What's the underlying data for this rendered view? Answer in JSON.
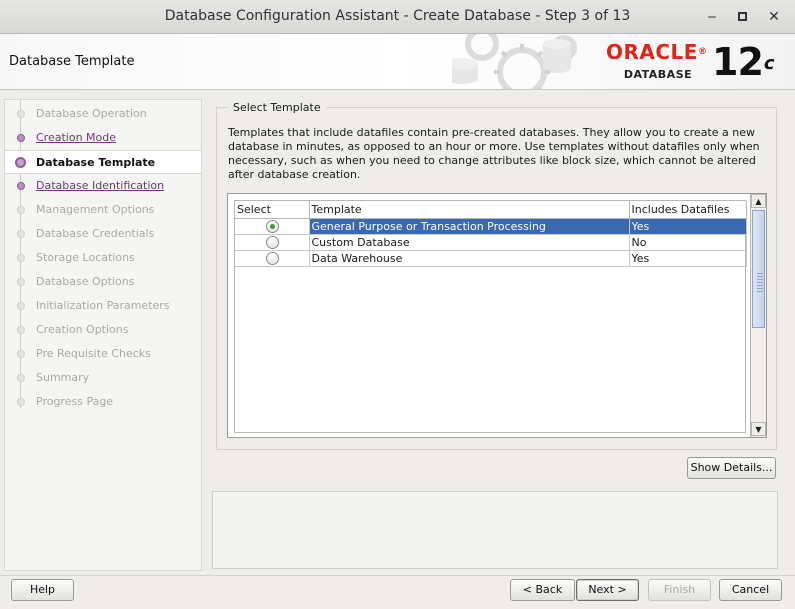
{
  "window": {
    "title": "Database Configuration Assistant - Create Database - Step 3 of 13",
    "minimize_glyph": "‒",
    "maximize_glyph": "■",
    "close_glyph": "✕"
  },
  "header": {
    "page_title": "Database Template",
    "logo_oracle": "ORACLE",
    "logo_registered": "®",
    "logo_database": "DATABASE",
    "logo_version": "12",
    "logo_version_suffix": "c"
  },
  "nav": {
    "items": [
      {
        "label": "Database Operation",
        "state": "disabled"
      },
      {
        "label": "Creation Mode",
        "state": "link"
      },
      {
        "label": "Database Template",
        "state": "active"
      },
      {
        "label": "Database Identification",
        "state": "link"
      },
      {
        "label": "Management Options",
        "state": "disabled"
      },
      {
        "label": "Database Credentials",
        "state": "disabled"
      },
      {
        "label": "Storage Locations",
        "state": "disabled"
      },
      {
        "label": "Database Options",
        "state": "disabled"
      },
      {
        "label": "Initialization Parameters",
        "state": "disabled"
      },
      {
        "label": "Creation Options",
        "state": "disabled"
      },
      {
        "label": "Pre Requisite Checks",
        "state": "disabled"
      },
      {
        "label": "Summary",
        "state": "disabled"
      },
      {
        "label": "Progress Page",
        "state": "disabled"
      }
    ]
  },
  "main": {
    "group_title": "Select Template",
    "description": "Templates that include datafiles contain pre-created databases. They allow you to create a new database in minutes, as opposed to an hour or more. Use templates without datafiles only when necessary, such as when you need to change attributes like block size, which cannot be altered after database creation.",
    "table": {
      "columns": [
        "Select",
        "Template",
        "Includes Datafiles"
      ],
      "rows": [
        {
          "selected": true,
          "template": "General Purpose or Transaction Processing",
          "datafiles": "Yes"
        },
        {
          "selected": false,
          "template": "Custom Database",
          "datafiles": "No"
        },
        {
          "selected": false,
          "template": "Data Warehouse",
          "datafiles": "Yes"
        }
      ]
    },
    "show_details_label": "Show Details..."
  },
  "footer": {
    "help_label": "Help",
    "back_label": "< Back",
    "next_label": "Next >",
    "finish_label": "Finish",
    "cancel_label": "Cancel"
  },
  "colors": {
    "accent_selection": "#3a69b1",
    "nav_link": "#7b2f86",
    "oracle_red": "#e2231a"
  },
  "icons": {
    "up_arrow": "▲",
    "down_arrow": "▼"
  }
}
